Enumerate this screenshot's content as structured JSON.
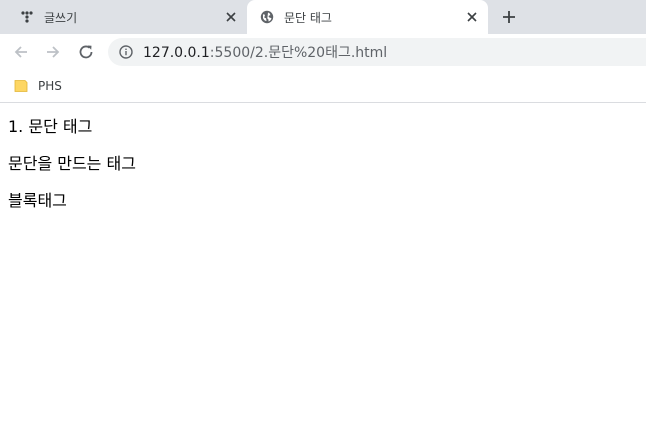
{
  "tabs": [
    {
      "title": "글쓰기",
      "icon": "dots-favicon-icon",
      "active": false
    },
    {
      "title": "문단 태그",
      "icon": "globe-icon",
      "active": true
    }
  ],
  "toolbar": {
    "url_host": "127.0.0.1",
    "url_rest": ":5500/2.문단%20태그.html"
  },
  "bookmarks": [
    {
      "label": "PHS",
      "icon": "folder-icon"
    }
  ],
  "page": {
    "line1": "1. 문단 태그",
    "line2": "문단을 만드는 태그",
    "line3": "블록태그"
  },
  "colors": {
    "tabstrip_bg": "#dee1e6",
    "omnibox_bg": "#f1f3f4",
    "folder": "#fdd663"
  }
}
